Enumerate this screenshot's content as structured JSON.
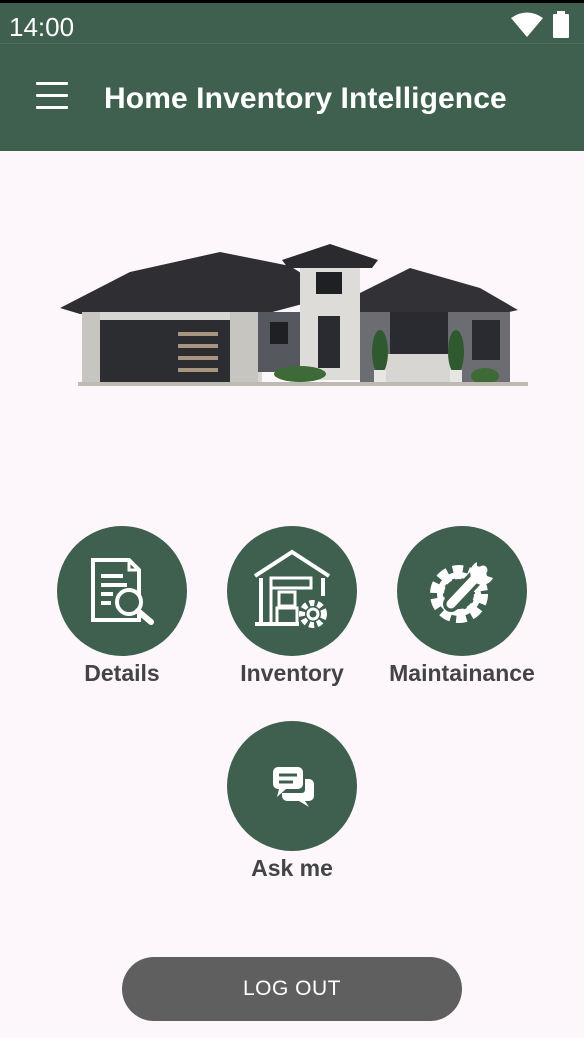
{
  "status_bar": {
    "time": "14:00"
  },
  "app_bar": {
    "title": "Home Inventory Intelligence"
  },
  "tiles": [
    {
      "label": "Details",
      "icon": "document-search-icon"
    },
    {
      "label": "Inventory",
      "icon": "warehouse-gear-icon"
    },
    {
      "label": "Maintainance",
      "icon": "wrench-gear-icon"
    },
    {
      "label": "Ask me",
      "icon": "chat-bubbles-icon"
    }
  ],
  "logout": {
    "label": "LOG OUT"
  },
  "colors": {
    "primary": "#3f5f4f",
    "background": "#fdf7fc",
    "button": "#5f5f5f",
    "label": "#444444"
  }
}
